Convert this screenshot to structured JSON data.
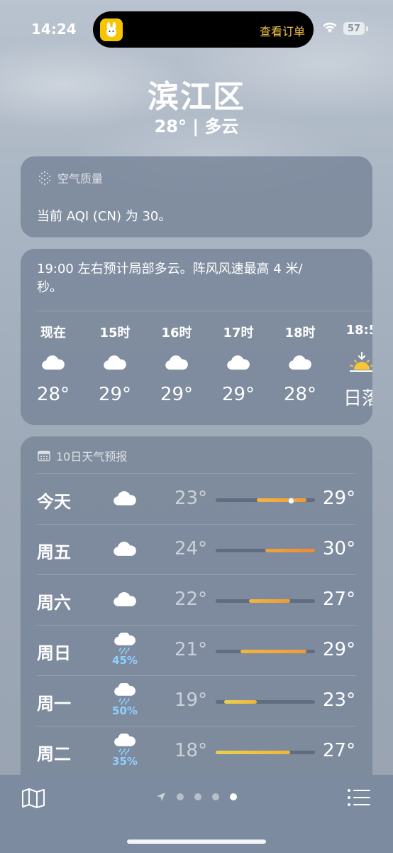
{
  "status_bar": {
    "time": "14:24",
    "island_text": "查看订单",
    "battery": "57"
  },
  "header": {
    "city": "滨江区",
    "subtitle": "28° | 多云"
  },
  "aqi": {
    "title": "空气质量",
    "text": "当前 AQI (CN) 为 30。"
  },
  "hourly": {
    "summary": "19:00 左右预计局部多云。阵风风速最高 4 米/秒。",
    "items": [
      {
        "label": "现在",
        "icon": "cloud-icon",
        "temp": "28°"
      },
      {
        "label": "15时",
        "icon": "cloud-icon",
        "temp": "29°"
      },
      {
        "label": "16时",
        "icon": "cloud-icon",
        "temp": "29°"
      },
      {
        "label": "17时",
        "icon": "cloud-icon",
        "temp": "29°"
      },
      {
        "label": "18时",
        "icon": "cloud-icon",
        "temp": "28°"
      },
      {
        "label": "18:5",
        "icon": "sunset-icon",
        "temp": "日落"
      }
    ]
  },
  "daily": {
    "title": "10日天气预报",
    "scale": [
      18,
      30
    ],
    "days": [
      {
        "day": "今天",
        "icon": "cloud-icon",
        "precip": "",
        "low": "23°",
        "high": "29°",
        "low_v": 23,
        "high_v": 29,
        "now_v": 27
      },
      {
        "day": "周五",
        "icon": "cloud-icon",
        "precip": "",
        "low": "24°",
        "high": "30°",
        "low_v": 24,
        "high_v": 30
      },
      {
        "day": "周六",
        "icon": "cloud-icon",
        "precip": "",
        "low": "22°",
        "high": "27°",
        "low_v": 22,
        "high_v": 27
      },
      {
        "day": "周日",
        "icon": "rain-cloud-icon",
        "precip": "45%",
        "low": "21°",
        "high": "29°",
        "low_v": 21,
        "high_v": 29
      },
      {
        "day": "周一",
        "icon": "rain-cloud-icon",
        "precip": "50%",
        "low": "19°",
        "high": "23°",
        "low_v": 19,
        "high_v": 23
      },
      {
        "day": "周二",
        "icon": "rain-cloud-icon",
        "precip": "35%",
        "low": "18°",
        "high": "27°",
        "low_v": 18,
        "high_v": 27
      }
    ]
  },
  "bottom_bar": {
    "map_icon": "map-icon",
    "list_icon": "list-icon",
    "page_count": 4,
    "active_page": 4
  }
}
